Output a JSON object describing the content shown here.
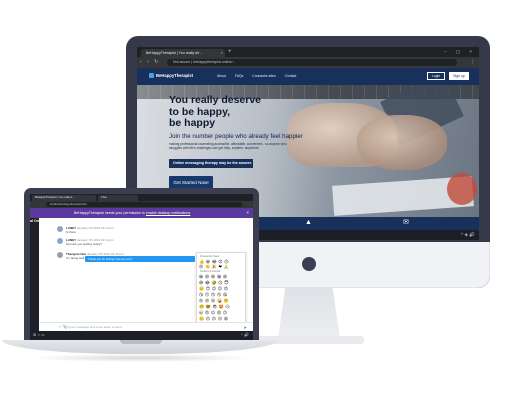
{
  "desktop": {
    "tab_title": "BeHappyTherapist | You really de...",
    "tab_close": "×",
    "new_tab": "+",
    "window_controls": "– ▢ ×",
    "nav_buttons": "‹ › ↻",
    "url": "Not secure | behappytherapist.online/...",
    "browser_menu": "⋮",
    "site": {
      "logo": "BeHappyTherapist",
      "links": [
        "About",
        "FAQs",
        "Counselor sites",
        "Contact"
      ],
      "login": "Login",
      "signup": "Sign up"
    },
    "hero": {
      "headline_1": "You really deserve",
      "headline_2": "to be happy,",
      "headline_3": "be happy",
      "subheadline": "Join the number people who already feel happier",
      "body": "making professional counseling accessible, affordable, convenient - so anyone who struggles with life's challenges can get help, anytime, anywhere.",
      "badge": "Online messaging therapy may be the answer.",
      "cta": "Get Started Now!"
    },
    "band_icons": [
      "✆",
      "▲",
      "✉"
    ],
    "taskbar_left": "⊞ ○ ▭",
    "taskbar_right": "^ ◈ 🔊"
  },
  "laptop": {
    "tab_1": "BeHappyTherapist | You really d...",
    "tab_2": "Chat",
    "url": "localhost/behappytherapist/chat",
    "notification": {
      "text": "BeHappyTherapist needs your permission to ",
      "link": "enable desktop notifications",
      "close": "×"
    },
    "sidebar_label": "al One (You)",
    "messages": [
      {
        "name": "LANEY",
        "time": "January 7th 2021 01:14 pm",
        "text": "hi there"
      },
      {
        "name": "LANEY",
        "time": "January 7th 2021 01:14 pm",
        "text": "how are you feeling today?"
      },
      {
        "name": "Therapist One",
        "time": "January 7th 2021 01:15 pm",
        "text": "I'm doing well"
      }
    ],
    "own_message": "Thank you for asking, how are you?",
    "emoji": {
      "category_1": "Frequently Used",
      "category_2": "Smileys & People",
      "rows": [
        "👍 😀 😂 😍 😊",
        "😢 👏 🎉 ❤ 🙏",
        "😀 😃 😄 😁 😆",
        "😅 😂 🤣 😊 😇",
        "🙂 🙃 😉 😌 😍",
        "😘 😗 😙 😚 😋",
        "😛 😝 😜 🤪 🤨",
        "🧐 🤓 😎 🤩 😏",
        "😒 😞 😔 😟 😕",
        "🙁 ☹ 😣 😖 😫",
        "😩 😢 😭 😤 😠"
      ]
    },
    "composer_icons": "☺ 📎",
    "composer_placeholder": "Type a message and press Enter to send",
    "send_icon": "➤",
    "taskbar_left": "⊞ ○ ▭",
    "taskbar_right": "^ 🔊"
  }
}
